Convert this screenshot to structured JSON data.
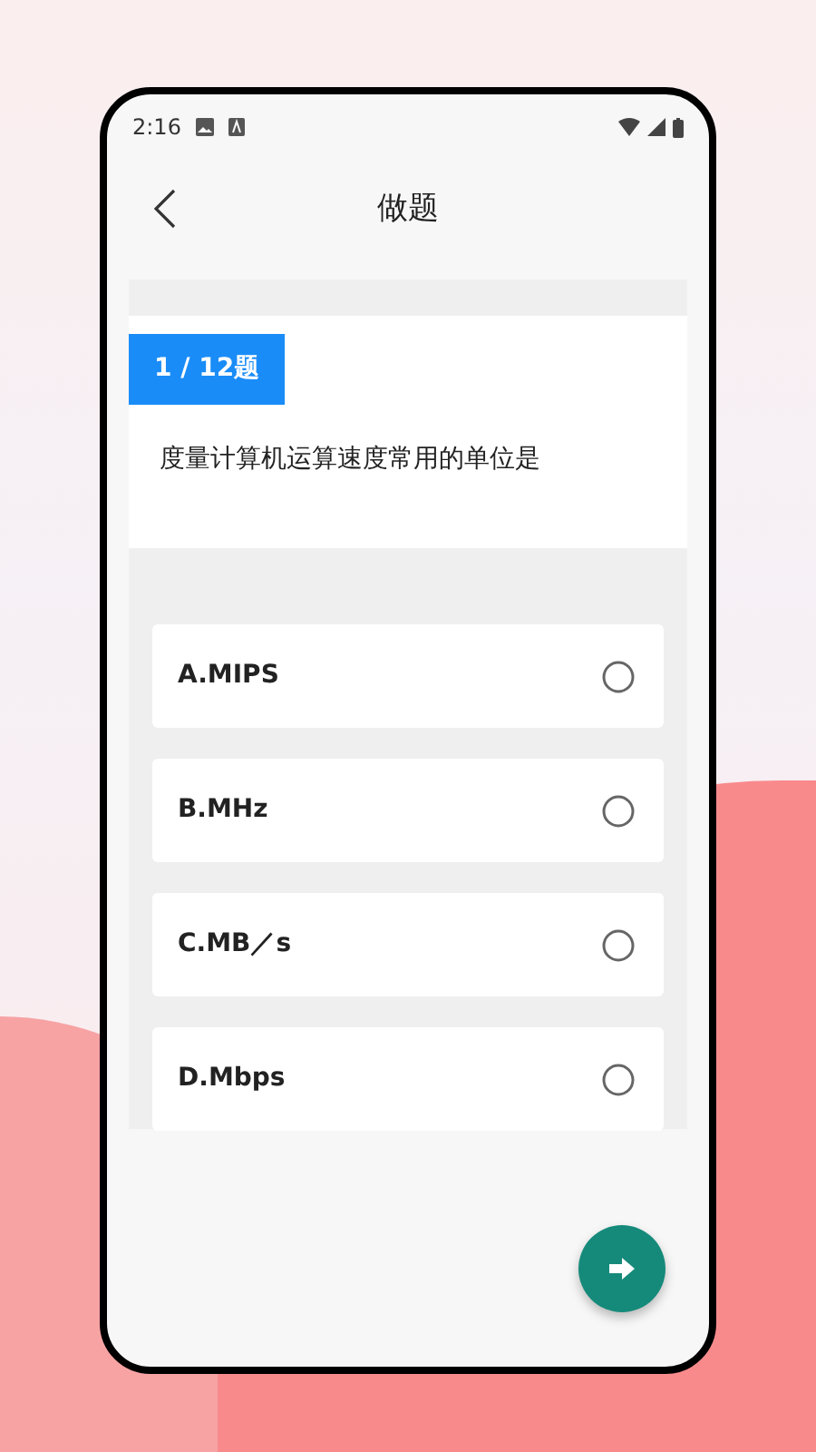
{
  "status_bar": {
    "time": "2:16"
  },
  "header": {
    "title": "做题"
  },
  "question": {
    "counter": "1 / 12题",
    "text": "度量计算机运算速度常用的单位是"
  },
  "options": [
    {
      "label": "A.MIPS",
      "selected": false
    },
    {
      "label": "B.MHz",
      "selected": false
    },
    {
      "label": "C.MB／s",
      "selected": false
    },
    {
      "label": "D.Mbps",
      "selected": false
    }
  ]
}
